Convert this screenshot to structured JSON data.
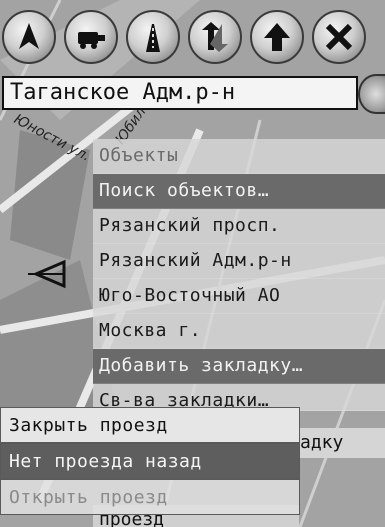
{
  "toolbar": {
    "buttons": [
      {
        "name": "navigation-arrow-icon"
      },
      {
        "name": "car-icon"
      },
      {
        "name": "road-icon"
      },
      {
        "name": "route-arrows-icon"
      },
      {
        "name": "up-arrow-icon"
      },
      {
        "name": "close-icon"
      }
    ]
  },
  "location": {
    "text": "Таганское Адм.р-н"
  },
  "streets": {
    "s1": "Юности ул.",
    "s2": "Юбил"
  },
  "menu": {
    "items": [
      {
        "label": "Объекты",
        "style": "header"
      },
      {
        "label": "Поиск объектов…",
        "style": "highlight"
      },
      {
        "label": "Рязанский просп.",
        "style": "normal"
      },
      {
        "label": "Рязанский Адм.р-н",
        "style": "normal"
      },
      {
        "label": "Юго-Восточный АО",
        "style": "normal"
      },
      {
        "label": "Москва г.",
        "style": "normal"
      },
      {
        "label": "Добавить закладку…",
        "style": "highlight"
      },
      {
        "label": "Св-ва закладки…",
        "style": "partial"
      }
    ],
    "peek_right": "адку",
    "peek_bottom": "проезд"
  },
  "submenu": {
    "items": [
      {
        "label": "Закрыть проезд",
        "style": "normal"
      },
      {
        "label": "Нет проезда назад",
        "style": "highlight"
      },
      {
        "label": "Открыть проезд",
        "style": "disabled"
      }
    ]
  },
  "colors": {
    "highlight": "#6a6a6a",
    "menu_bg": "#d7d7d7",
    "map_bg": "#9a9a9a"
  }
}
